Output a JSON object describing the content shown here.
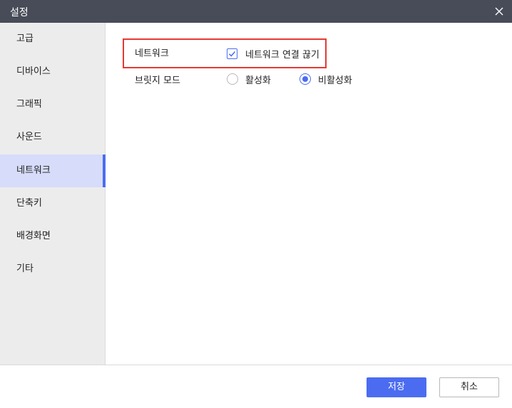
{
  "window": {
    "title": "설정"
  },
  "sidebar": {
    "items": [
      {
        "label": "고급"
      },
      {
        "label": "디바이스"
      },
      {
        "label": "그래픽"
      },
      {
        "label": "사운드"
      },
      {
        "label": "네트워크",
        "active": true
      },
      {
        "label": "단축키"
      },
      {
        "label": "배경화면"
      },
      {
        "label": "기타"
      }
    ]
  },
  "network": {
    "section_label": "네트워크",
    "disconnect": {
      "label": "네트워크 연결 끊기",
      "checked": true
    },
    "bridge_mode": {
      "label": "브릿지 모드",
      "options": [
        {
          "label": "활성화",
          "selected": false
        },
        {
          "label": "비활성화",
          "selected": true
        }
      ]
    }
  },
  "footer": {
    "save_label": "저장",
    "cancel_label": "취소"
  },
  "colors": {
    "accent": "#4b6cf0",
    "titlebar": "#474c58",
    "highlight_border": "#e53935"
  },
  "icons": {
    "close": "close-icon",
    "check": "check-icon"
  }
}
